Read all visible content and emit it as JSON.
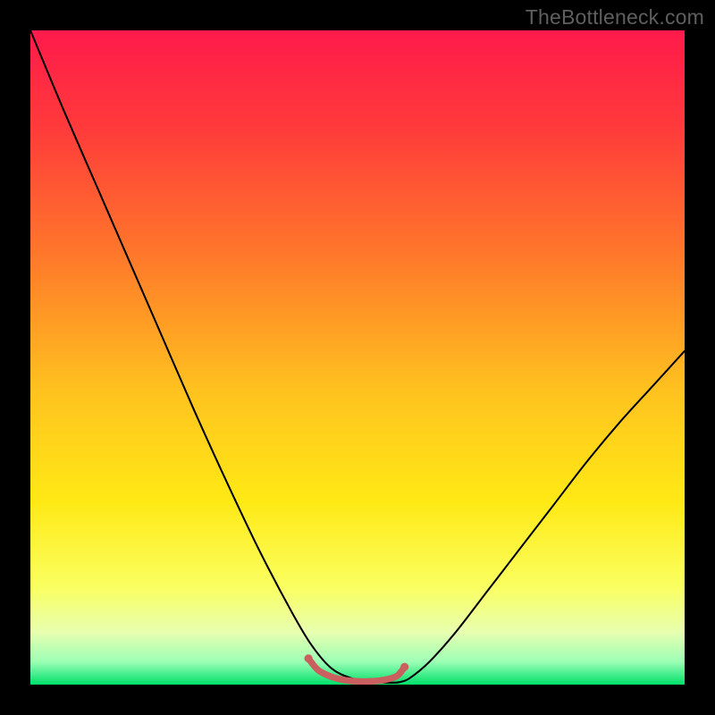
{
  "watermark": "TheBottleneck.com",
  "chart_data": {
    "type": "line",
    "title": "",
    "xlabel": "",
    "ylabel": "",
    "xlim": [
      0,
      100
    ],
    "ylim": [
      0,
      100
    ],
    "grid": false,
    "legend": false,
    "gradient_stops": [
      {
        "pos": 0.0,
        "color": "#ff1a4b"
      },
      {
        "pos": 0.15,
        "color": "#ff3b3b"
      },
      {
        "pos": 0.35,
        "color": "#ff7a2a"
      },
      {
        "pos": 0.55,
        "color": "#ffc21f"
      },
      {
        "pos": 0.72,
        "color": "#ffe915"
      },
      {
        "pos": 0.85,
        "color": "#faff60"
      },
      {
        "pos": 0.92,
        "color": "#e8ffb0"
      },
      {
        "pos": 0.965,
        "color": "#9cffb5"
      },
      {
        "pos": 1.0,
        "color": "#00e06a"
      }
    ],
    "series": [
      {
        "name": "bottleneck-curve",
        "color": "#000000",
        "x": [
          0,
          5,
          10,
          15,
          20,
          25,
          30,
          35,
          40,
          43,
          46,
          49,
          52,
          55,
          56.5,
          58,
          61,
          65,
          70,
          75,
          80,
          85,
          90,
          95,
          100
        ],
        "y": [
          100,
          88,
          76.5,
          65,
          53.5,
          42,
          31,
          20.5,
          11,
          6,
          2.5,
          1,
          0.4,
          0.3,
          0.4,
          1,
          3.5,
          8,
          14.5,
          21,
          27.5,
          34,
          40,
          45.5,
          51
        ]
      },
      {
        "name": "flat-bottom-marker",
        "color": "#c9605f",
        "stroke_width": 7,
        "x": [
          42.5,
          44,
          46,
          48,
          50,
          52,
          54,
          56,
          57.2
        ],
        "y": [
          4.0,
          2.2,
          1.2,
          0.7,
          0.5,
          0.5,
          0.7,
          1.3,
          2.7
        ]
      }
    ],
    "markers": [
      {
        "x": 42.5,
        "y": 4.0,
        "r": 4.6,
        "color": "#c9605f"
      },
      {
        "x": 57.2,
        "y": 2.7,
        "r": 4.6,
        "color": "#c9605f"
      }
    ]
  }
}
